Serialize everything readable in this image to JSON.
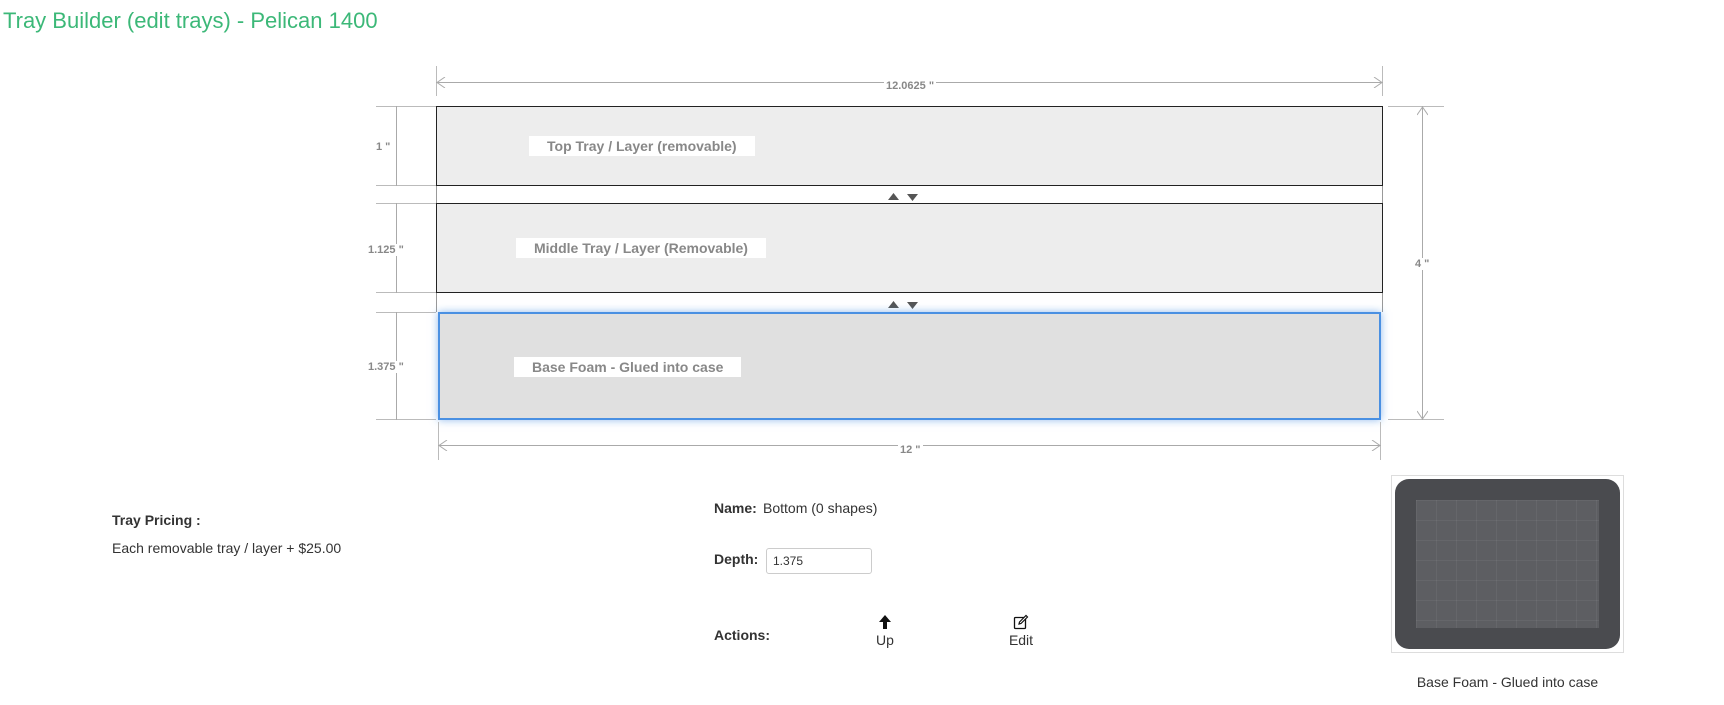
{
  "page": {
    "title": "Tray Builder (edit trays) - Pelican 1400"
  },
  "diagram": {
    "top_width_label": "12.0625 \"",
    "bottom_width_label": "12 \"",
    "total_depth_label": "4 \"",
    "trays": [
      {
        "label": "Top Tray / Layer (removable)",
        "depth_label": "1 \""
      },
      {
        "label": "Middle Tray / Layer (Removable)",
        "depth_label": "1.125 \""
      },
      {
        "label": "Base Foam - Glued into case",
        "depth_label": "1.375 \""
      }
    ]
  },
  "pricing": {
    "title": "Tray Pricing :",
    "text": "Each removable tray / layer + $25.00"
  },
  "details": {
    "name_label": "Name:",
    "name_value": "Bottom (0 shapes)",
    "depth_label": "Depth:",
    "depth_value": "1.375",
    "actions_label": "Actions:",
    "up_label": "Up",
    "edit_label": "Edit"
  },
  "preview": {
    "caption": "Base Foam - Glued into case"
  },
  "colors": {
    "title": "#3cb878",
    "selected_border": "#4a90e2"
  }
}
